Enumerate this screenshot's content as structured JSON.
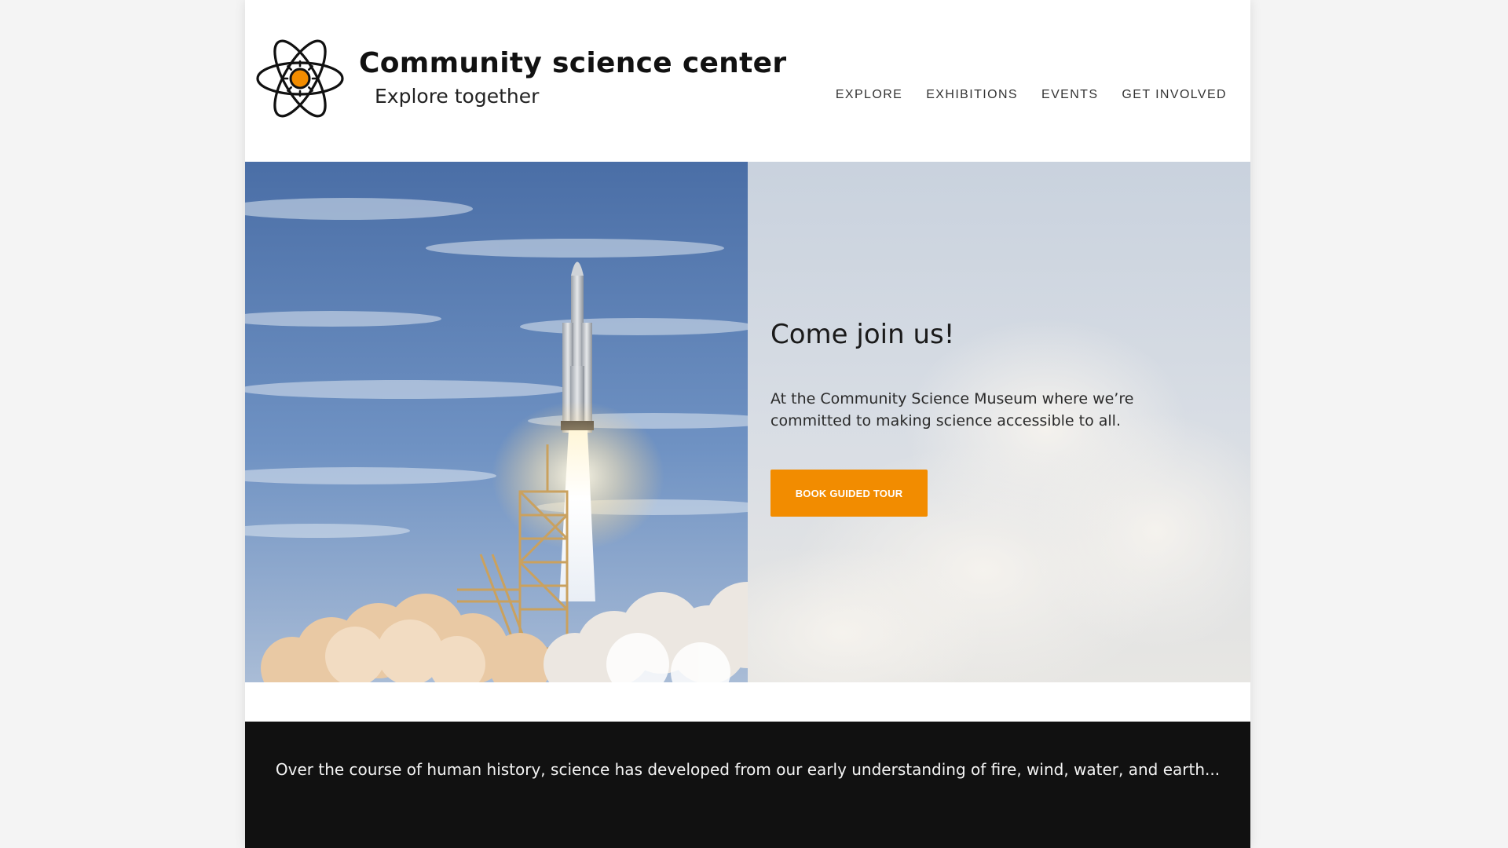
{
  "brand": {
    "title": "Community science center",
    "tagline": "Explore together",
    "accent_color": "#f28c00",
    "logo_icon": "atom-sun-icon"
  },
  "nav": {
    "items": [
      {
        "label": "EXPLORE"
      },
      {
        "label": "EXHIBITIONS"
      },
      {
        "label": "EVENTS"
      },
      {
        "label": "GET INVOLVED"
      }
    ]
  },
  "hero": {
    "image": "rocket-launch-image",
    "heading": "Come join us!",
    "text": "At the Community Science Museum where we’re committed to making science accessible to all.",
    "button_label": "BOOK GUIDED TOUR"
  },
  "history": {
    "text": "Over the course of human history, science has developed from our early understanding of fire, wind, water, and earth..."
  }
}
